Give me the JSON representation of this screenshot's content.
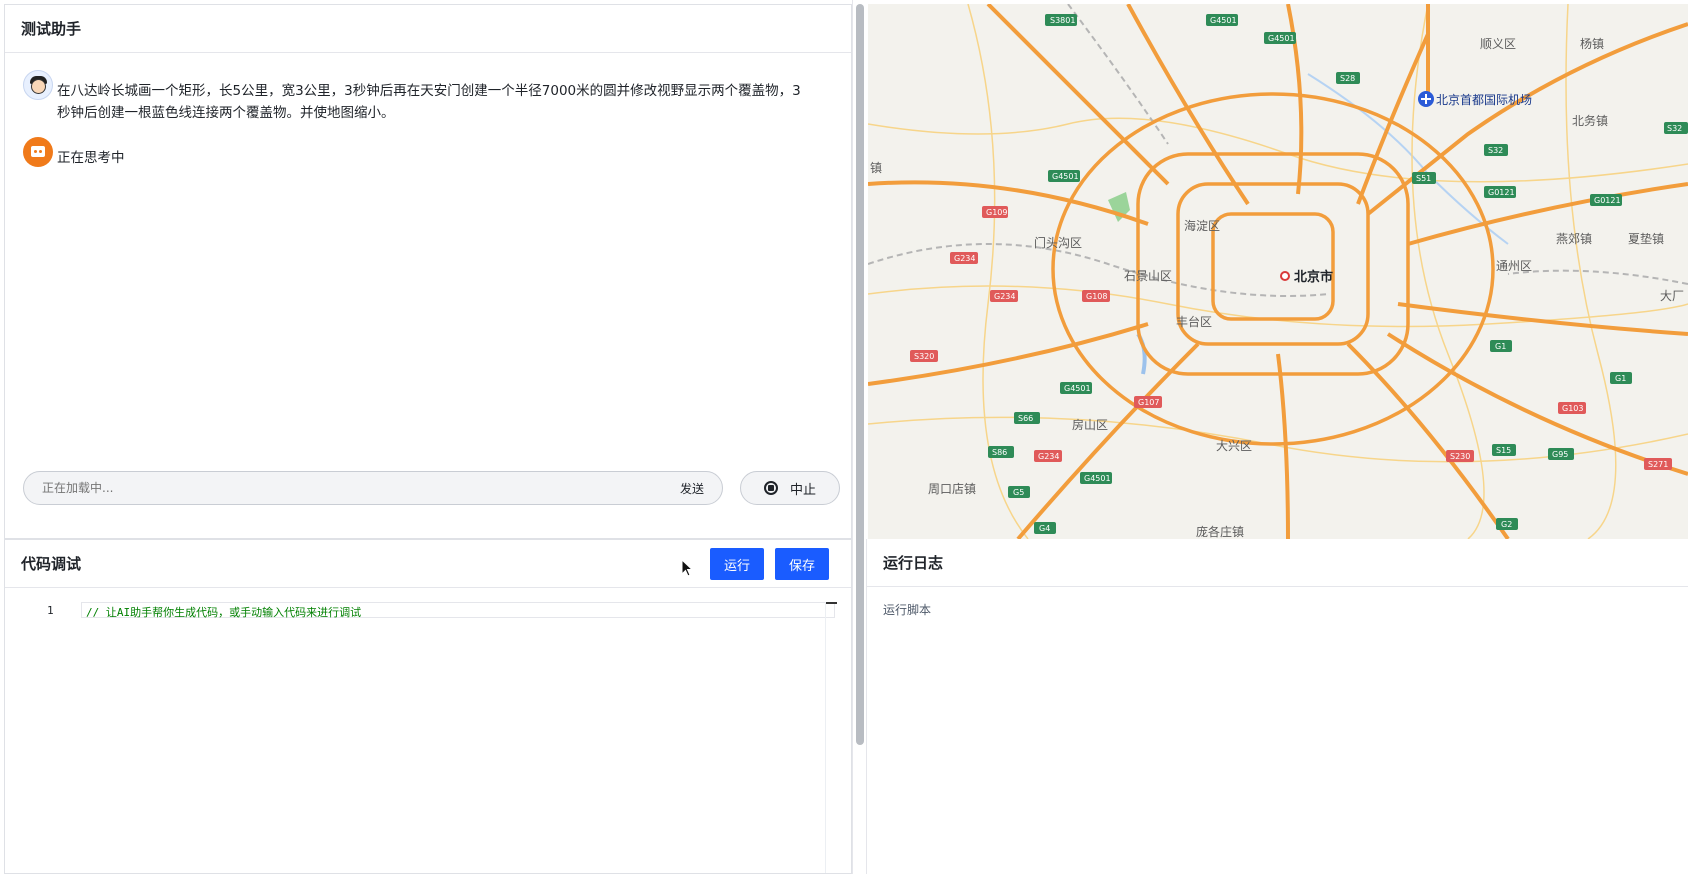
{
  "chat": {
    "title": "测试助手",
    "messages": [
      {
        "role": "user",
        "text": "在八达岭长城画一个矩形，长5公里，宽3公里，3秒钟后再在天安门创建一个半径7000米的圆并修改视野显示两个覆盖物，3秒钟后创建一根蓝色线连接两个覆盖物。并使地图缩小。"
      },
      {
        "role": "assistant",
        "text": "正在思考中"
      }
    ],
    "input_placeholder": "正在加载中...",
    "send_label": "发送",
    "stop_label": "中止"
  },
  "code": {
    "title": "代码调试",
    "run_label": "运行",
    "save_label": "保存",
    "line_number": "1",
    "line_text": "// 让AI助手帮你生成代码，或手动输入代码来进行调试"
  },
  "log": {
    "title": "运行日志",
    "entry": "运行脚本"
  },
  "map": {
    "labels": {
      "shunyi": "顺义区",
      "yangzhen": "杨镇",
      "airport": "北京首都国际机场",
      "beiwu": "北务镇",
      "haidian": "海淀区",
      "mentougou": "门头沟区",
      "shijingshan": "石景山区",
      "beijing": "北京市",
      "fengtai": "丰台区",
      "tongzhou": "通州区",
      "yanjiao": "燕郊镇",
      "xiadian": "夏垫镇",
      "dachang": "大厂",
      "fangshan": "房山区",
      "daxing": "大兴区",
      "zhoukoudian": "周口店镇",
      "pangezhuang": "庞各庄镇",
      "left_edge": "镇"
    },
    "shields": {
      "s3801": "S3801",
      "g4501a": "G4501",
      "g4501b": "G4501",
      "s28": "S28",
      "s32a": "S32",
      "s32b": "S32",
      "g4501c": "G4501",
      "s51": "S51",
      "g0121a": "G0121",
      "g0121b": "G0121",
      "g109": "G109",
      "g234a": "G234",
      "g234b": "G234",
      "g108": "G108",
      "s320": "S320",
      "g4501d": "G4501",
      "g107": "G107",
      "s66": "S66",
      "s86": "S86",
      "g234c": "G234",
      "g4501e": "G4501",
      "g5": "G5",
      "g4": "G4",
      "g1a": "G1",
      "g1b": "G1",
      "g103": "G103",
      "s15": "S15",
      "g95": "G95",
      "s230": "S230",
      "s271": "S271",
      "g2": "G2"
    }
  },
  "colors": {
    "primary_button": "#1a5cff",
    "code_comment": "#008000",
    "highway_orange": "#f29d3c",
    "bot_avatar": "#f07a1a"
  }
}
